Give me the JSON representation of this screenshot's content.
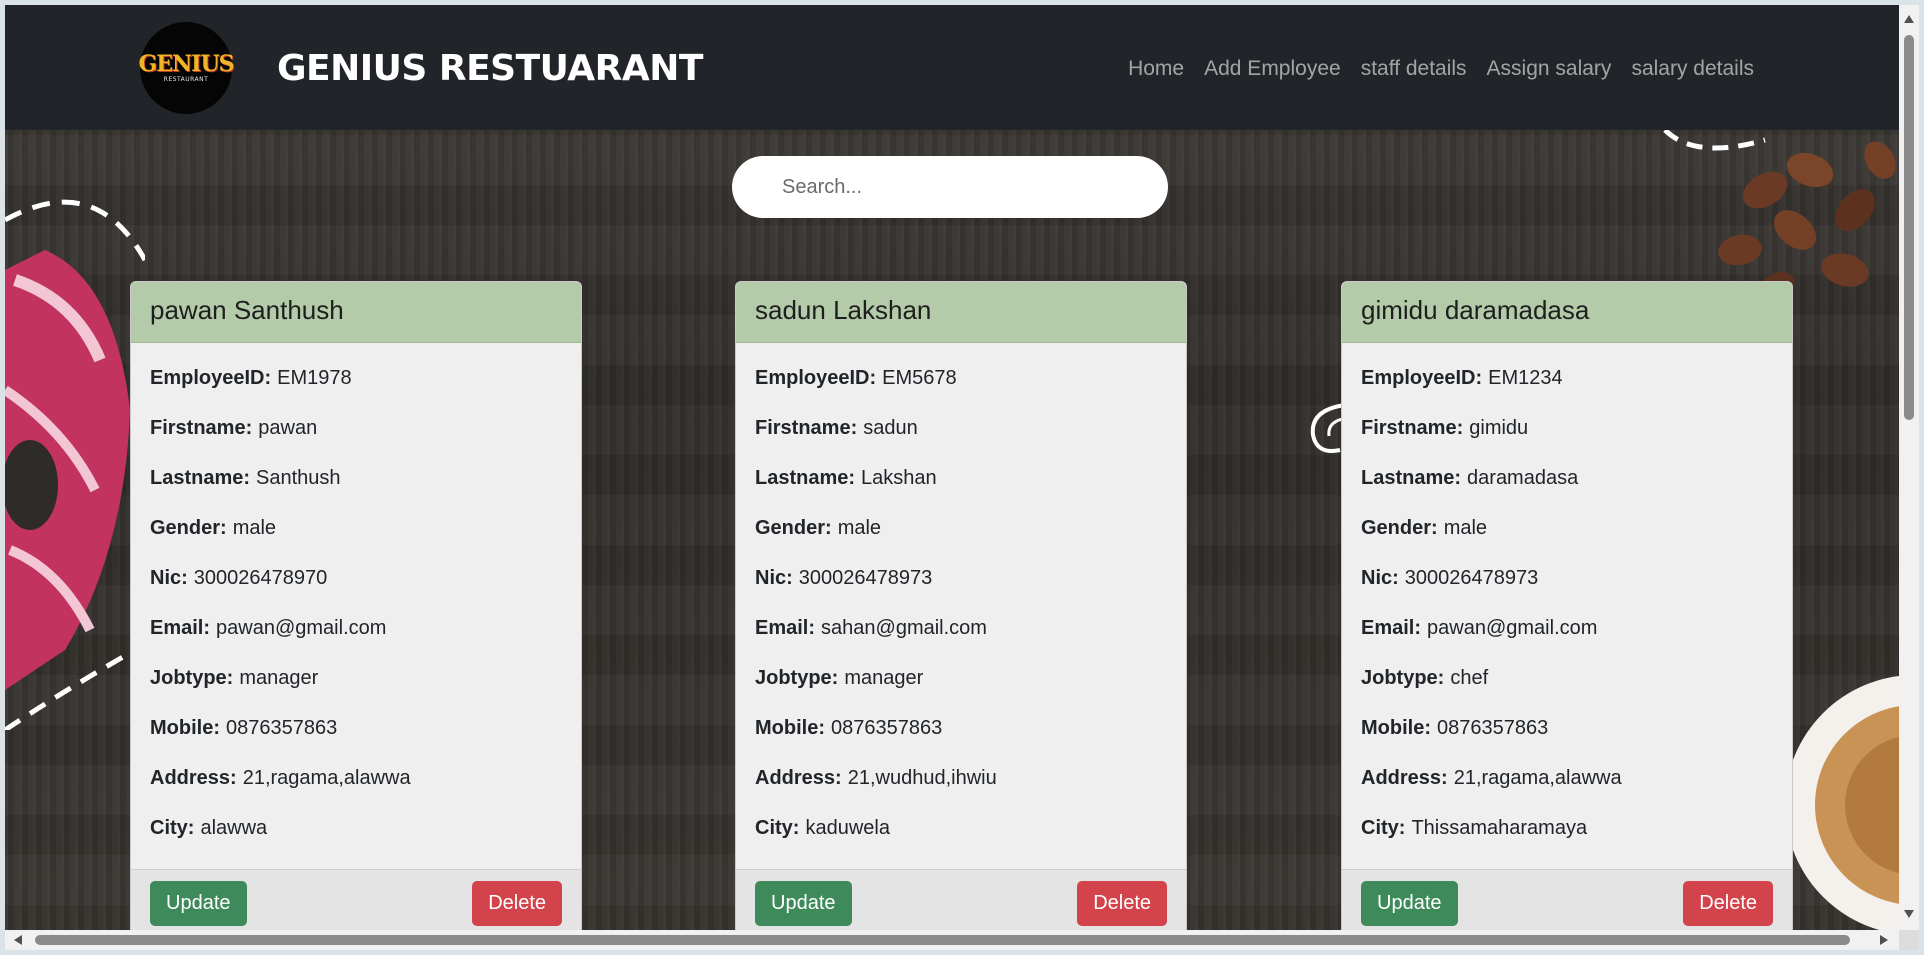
{
  "brand": {
    "name": "GENIUS RESTUARANT",
    "logo_word": "GENIUS",
    "logo_sub": "RESTAURANT"
  },
  "nav": {
    "items": [
      "Home",
      "Add Employee",
      "staff details",
      "Assign salary",
      "salary details"
    ]
  },
  "search": {
    "placeholder": "Search..."
  },
  "cards": [
    {
      "title": "pawan Santhush",
      "fields": [
        {
          "label": "EmployeeID:",
          "value": "EM1978"
        },
        {
          "label": "Firstname:",
          "value": "pawan"
        },
        {
          "label": "Lastname:",
          "value": "Santhush"
        },
        {
          "label": "Gender:",
          "value": "male"
        },
        {
          "label": "Nic:",
          "value": "300026478970"
        },
        {
          "label": "Email:",
          "value": "pawan@gmail.com"
        },
        {
          "label": "Jobtype:",
          "value": "manager"
        },
        {
          "label": "Mobile:",
          "value": "0876357863"
        },
        {
          "label": "Address:",
          "value": "21,ragama,alawwa"
        },
        {
          "label": "City:",
          "value": "alawwa"
        }
      ],
      "update_label": "Update",
      "delete_label": "Delete"
    },
    {
      "title": "sadun Lakshan",
      "fields": [
        {
          "label": "EmployeeID:",
          "value": "EM5678"
        },
        {
          "label": "Firstname:",
          "value": "sadun"
        },
        {
          "label": "Lastname:",
          "value": "Lakshan"
        },
        {
          "label": "Gender:",
          "value": "male"
        },
        {
          "label": "Nic:",
          "value": "300026478973"
        },
        {
          "label": "Email:",
          "value": "sahan@gmail.com"
        },
        {
          "label": "Jobtype:",
          "value": "manager"
        },
        {
          "label": "Mobile:",
          "value": "0876357863"
        },
        {
          "label": "Address:",
          "value": "21,wudhud,ihwiu"
        },
        {
          "label": "City:",
          "value": "kaduwela"
        }
      ],
      "update_label": "Update",
      "delete_label": "Delete"
    },
    {
      "title": "gimidu daramadasa",
      "fields": [
        {
          "label": "EmployeeID:",
          "value": "EM1234"
        },
        {
          "label": "Firstname:",
          "value": "gimidu"
        },
        {
          "label": "Lastname:",
          "value": "daramadasa"
        },
        {
          "label": "Gender:",
          "value": "male"
        },
        {
          "label": "Nic:",
          "value": "300026478973"
        },
        {
          "label": "Email:",
          "value": "pawan@gmail.com"
        },
        {
          "label": "Jobtype:",
          "value": "chef"
        },
        {
          "label": "Mobile:",
          "value": "0876357863"
        },
        {
          "label": "Address:",
          "value": "21,ragama,alawwa"
        },
        {
          "label": "City:",
          "value": "Thissamaharamaya"
        }
      ],
      "update_label": "Update",
      "delete_label": "Delete"
    }
  ],
  "colors": {
    "navbar": "#212529",
    "card_header": "#b3cba9",
    "update_button": "#3e8a5a",
    "delete_button": "#d2434b"
  }
}
